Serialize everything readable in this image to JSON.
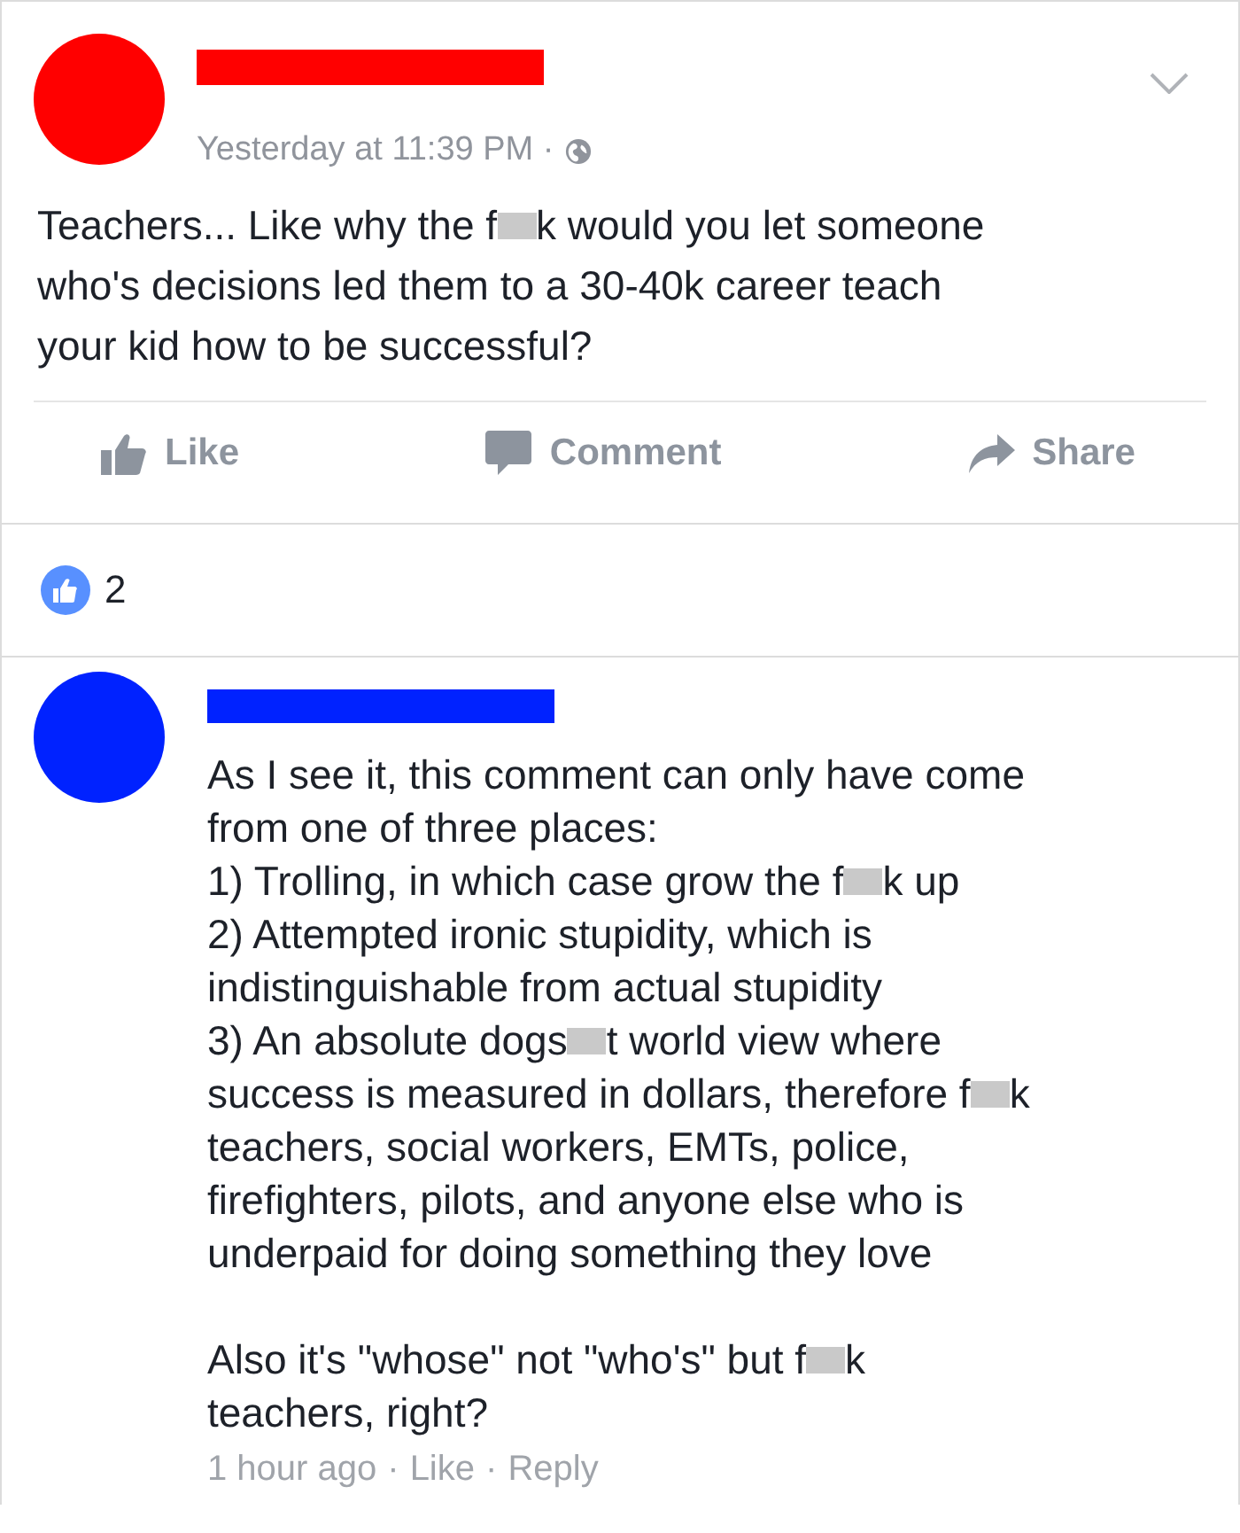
{
  "post": {
    "author": {
      "color": "#ff0000"
    },
    "timestamp": "Yesterday at 11:39 PM ·",
    "lines": [
      [
        {
          "kind": "text",
          "text": "Teachers... Like why the f"
        },
        {
          "kind": "censor"
        },
        {
          "kind": "text",
          "text": "k would you let someone"
        }
      ],
      [
        {
          "kind": "text",
          "text": "who's decisions led them to a 30-40k career teach"
        }
      ],
      [
        {
          "kind": "text",
          "text": "your kid how to be successful?"
        }
      ]
    ],
    "actions": [
      {
        "kind": "like",
        "label": "Like"
      },
      {
        "kind": "comment",
        "label": "Comment"
      },
      {
        "kind": "share",
        "label": "Share"
      }
    ]
  },
  "likes": {
    "count": "2"
  },
  "comment": {
    "author": {
      "color": "#0022ff"
    },
    "lines": [
      [
        {
          "kind": "text",
          "text": "As I see it, this comment can only have come"
        }
      ],
      [
        {
          "kind": "text",
          "text": "from one of three places:"
        }
      ],
      [
        {
          "kind": "text",
          "text": "1) Trolling, in which case grow the f"
        },
        {
          "kind": "censor"
        },
        {
          "kind": "text",
          "text": "k up"
        }
      ],
      [
        {
          "kind": "text",
          "text": "2) Attempted ironic stupidity, which is"
        }
      ],
      [
        {
          "kind": "text",
          "text": "indistinguishable from actual stupidity"
        }
      ],
      [
        {
          "kind": "text",
          "text": "3) An absolute dogs"
        },
        {
          "kind": "censor"
        },
        {
          "kind": "text",
          "text": "t world view where"
        }
      ],
      [
        {
          "kind": "text",
          "text": "success is measured in dollars, therefore f"
        },
        {
          "kind": "censor"
        },
        {
          "kind": "text",
          "text": "k"
        }
      ],
      [
        {
          "kind": "text",
          "text": "teachers, social workers, EMTs, police,"
        }
      ],
      [
        {
          "kind": "text",
          "text": "firefighters, pilots, and anyone else who is"
        }
      ],
      [
        {
          "kind": "text",
          "text": "underpaid for doing something they love"
        }
      ],
      [
        {
          "kind": "blank"
        }
      ],
      [
        {
          "kind": "text",
          "text": "Also it's \"whose\" not \"who's\" but f"
        },
        {
          "kind": "censor"
        },
        {
          "kind": "text",
          "text": "k"
        }
      ],
      [
        {
          "kind": "text",
          "text": "teachers, right?"
        }
      ]
    ],
    "meta": {
      "timestamp": "1 hour ago",
      "separators": [
        "·",
        "·"
      ],
      "actions": [
        "Like",
        "Reply"
      ]
    }
  }
}
